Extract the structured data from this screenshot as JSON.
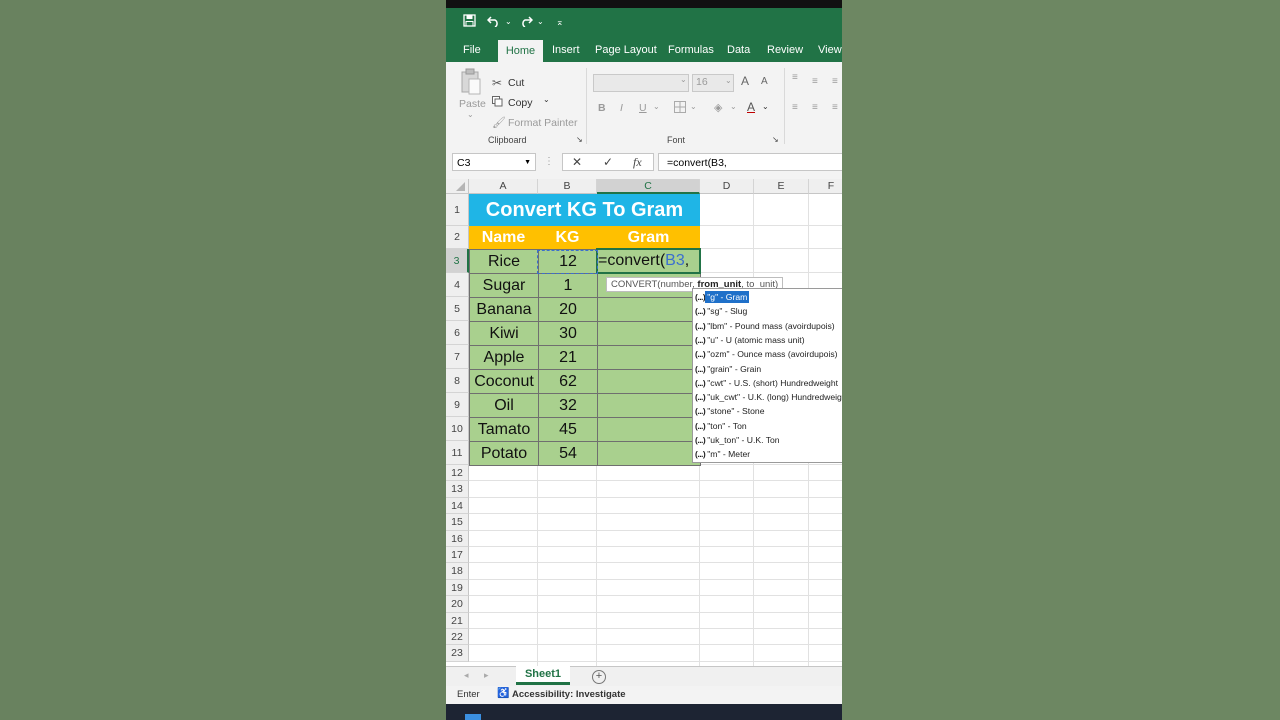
{
  "quick_access": {
    "save_icon": "save-icon",
    "undo_icon": "undo-icon",
    "redo_icon": "redo-icon",
    "customize_icon": "customize-icon"
  },
  "tabs": [
    "File",
    "Home",
    "Insert",
    "Page Layout",
    "Formulas",
    "Data",
    "Review",
    "View"
  ],
  "active_tab": "Home",
  "ribbon": {
    "paste": "Paste",
    "cut": "Cut",
    "copy": "Copy",
    "format_painter": "Format Painter",
    "clipboard_label": "Clipboard",
    "font_size": "16",
    "bold": "B",
    "italic": "I",
    "underline": "U",
    "grow_font": "A",
    "shrink_font": "A",
    "font_color": "A",
    "font_label": "Font"
  },
  "formula_bar": {
    "name_box": "C3",
    "cancel": "✕",
    "enter": "✓",
    "fx": "fx",
    "formula": "=convert(B3,"
  },
  "columns": [
    "A",
    "B",
    "C",
    "D",
    "E",
    "F"
  ],
  "rows": [
    "1",
    "2",
    "3",
    "4",
    "5",
    "6",
    "7",
    "8",
    "9",
    "10",
    "11",
    "12",
    "13",
    "14",
    "15",
    "16",
    "17",
    "18",
    "19",
    "20",
    "21",
    "22",
    "23"
  ],
  "sheet": {
    "title": "Convert KG To Gram",
    "headers": {
      "name": "Name",
      "kg": "KG",
      "gram": "Gram"
    },
    "data": [
      {
        "name": "Rice",
        "kg": "12"
      },
      {
        "name": "Sugar",
        "kg": "1"
      },
      {
        "name": "Banana",
        "kg": "20"
      },
      {
        "name": "Kiwi",
        "kg": "30"
      },
      {
        "name": "Apple",
        "kg": "21"
      },
      {
        "name": "Coconut",
        "kg": "62"
      },
      {
        "name": "Oil",
        "kg": "32"
      },
      {
        "name": "Tamato",
        "kg": "45"
      },
      {
        "name": "Potato",
        "kg": "54"
      }
    ],
    "edit_cell": {
      "prefix": "=convert(",
      "ref": "B3",
      "suffix": ","
    }
  },
  "tooltip": {
    "prefix": "CONVERT(number, ",
    "bold": "from_unit",
    "suffix": ", to_unit)"
  },
  "autocomplete": [
    "\"g\" - Gram",
    "\"sg\" - Slug",
    "\"lbm\" - Pound mass (avoirdupois)",
    "\"u\" - U (atomic mass unit)",
    "\"ozm\" - Ounce mass (avoirdupois)",
    "\"grain\" - Grain",
    "\"cwt\" - U.S. (short) Hundredweight",
    "\"uk_cwt\" - U.K. (long) Hundredweight",
    "\"stone\" - Stone",
    "\"ton\" - Ton",
    "\"uk_ton\" - U.K. Ton",
    "\"m\" - Meter"
  ],
  "autocomplete_icon": "(...)",
  "sheet_tab": "Sheet1",
  "status": {
    "mode": "Enter",
    "accessibility": "Accessibility: Investigate"
  },
  "colors": {
    "excel_green": "#217346",
    "title_fill": "#1fb5e6",
    "header_fill": "#ffc000",
    "data_fill": "#a9d08e",
    "highlight": "#1f70c9"
  }
}
